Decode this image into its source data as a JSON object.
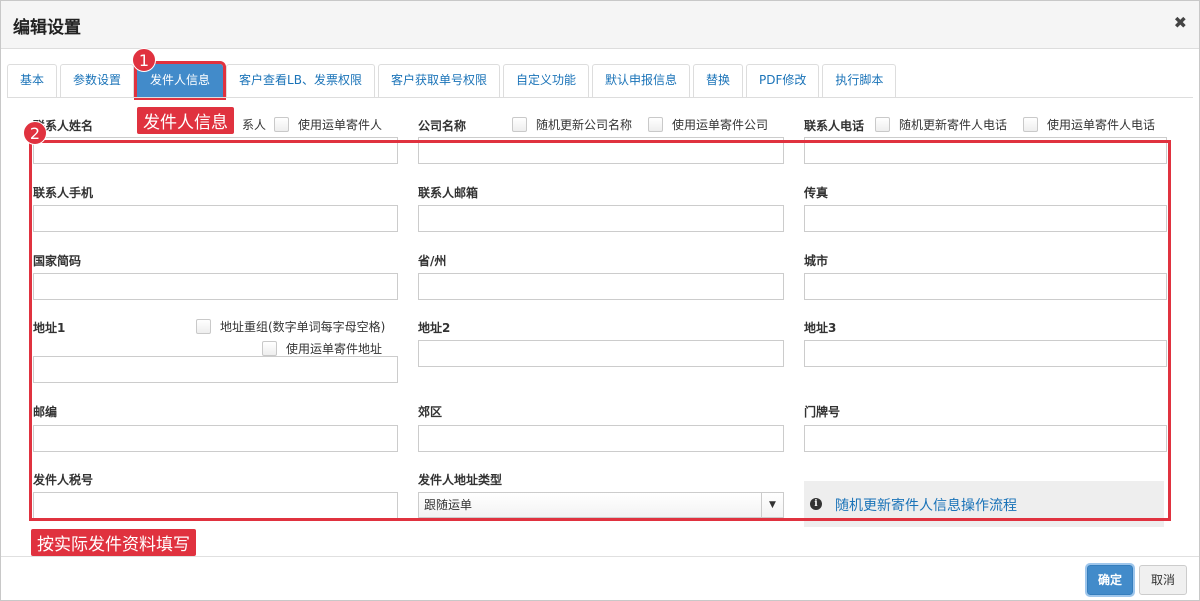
{
  "dialog": {
    "title": "编辑设置",
    "close_glyph": "✖"
  },
  "tabs": [
    {
      "label": "基本"
    },
    {
      "label": "参数设置"
    },
    {
      "label": "发件人信息",
      "active": true
    },
    {
      "label": "客户查看LB、发票权限"
    },
    {
      "label": "客户获取单号权限"
    },
    {
      "label": "自定义功能"
    },
    {
      "label": "默认申报信息"
    },
    {
      "label": "替换"
    },
    {
      "label": "PDF修改"
    },
    {
      "label": "执行脚本"
    }
  ],
  "annotations": {
    "badge1": "1",
    "badge2": "2",
    "label1": "发件人信息",
    "label2": "按实际发件资料填写",
    "color": "#e0323f"
  },
  "form": {
    "contact_name": {
      "label": "联系人姓名",
      "checkbox_partial": "系人",
      "checkbox2": "使用运单寄件人"
    },
    "company": {
      "label": "公司名称",
      "checkbox1": "随机更新公司名称",
      "checkbox2": "使用运单寄件公司"
    },
    "phone": {
      "label": "联系人电话",
      "checkbox1": "随机更新寄件人电话",
      "checkbox2": "使用运单寄件人电话"
    },
    "mobile": {
      "label": "联系人手机"
    },
    "email": {
      "label": "联系人邮箱"
    },
    "fax": {
      "label": "传真"
    },
    "country_code": {
      "label": "国家简码"
    },
    "province": {
      "label": "省/州"
    },
    "city": {
      "label": "城市"
    },
    "address1": {
      "label": "地址1",
      "checkbox1": "地址重组(数字单词每字母空格)",
      "checkbox2": "使用运单寄件地址"
    },
    "address2": {
      "label": "地址2"
    },
    "address3": {
      "label": "地址3"
    },
    "postcode": {
      "label": "邮编"
    },
    "district": {
      "label": "郊区"
    },
    "house_number": {
      "label": "门牌号"
    },
    "tax_id": {
      "label": "发件人税号"
    },
    "address_type": {
      "label": "发件人地址类型",
      "selected": "跟随运单"
    }
  },
  "info": {
    "icon": "i",
    "link": "随机更新寄件人信息操作流程"
  },
  "footer": {
    "ok": "确定",
    "cancel": "取消"
  }
}
